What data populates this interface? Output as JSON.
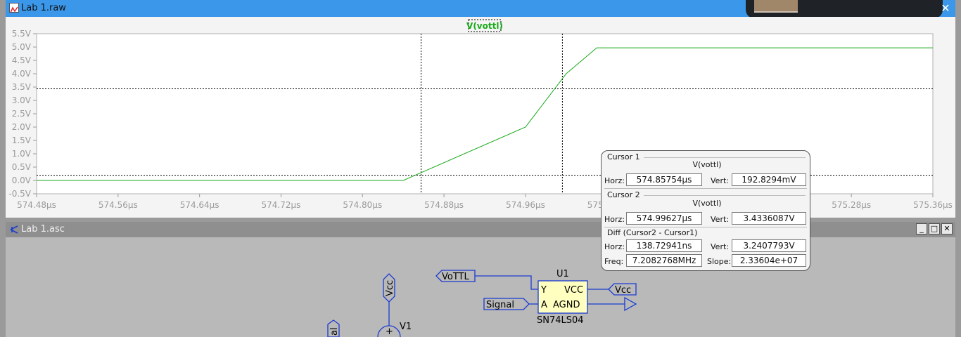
{
  "wave_window": {
    "title": "Lab 1.raw",
    "close_label": "✕",
    "trace_label": "V(vottl)",
    "colors": {
      "trace": "#1aaa1a",
      "grid_tick": "#9a9a9a",
      "titlebar": "#3b97ea"
    }
  },
  "chart_data": {
    "type": "line",
    "title": "",
    "xlabel": "",
    "ylabel": "",
    "x_ticks": [
      "574.48µs",
      "574.56µs",
      "574.64µs",
      "574.72µs",
      "574.80µs",
      "574.88µs",
      "574.96µs",
      "575.04µs",
      "575.12µs",
      "575.20µs",
      "575.28µs",
      "575.36µs"
    ],
    "y_ticks": [
      "5.5V",
      "5.0V",
      "4.5V",
      "4.0V",
      "3.5V",
      "3.0V",
      "2.5V",
      "2.0V",
      "1.5V",
      "1.0V",
      "0.5V",
      "0.0V",
      "-0.5V"
    ],
    "xlim_us": [
      574.48,
      575.36
    ],
    "ylim_v": [
      -0.5,
      5.5
    ],
    "series": [
      {
        "name": "V(vottl)",
        "x_us": [
          574.48,
          574.84,
          574.96,
          575.0,
          575.03,
          575.36
        ],
        "y_v": [
          0.0,
          0.0,
          2.0,
          4.0,
          4.97,
          4.97
        ]
      }
    ],
    "cursors": {
      "x1_us": 574.85754,
      "x2_us": 574.99627,
      "y1_v": 0.1928294,
      "y2_v": 3.4336087
    }
  },
  "cursor_dialog": {
    "cursor1": {
      "group": "Cursor 1",
      "trace": "V(vottl)",
      "horz_label": "Horz:",
      "horz": "574.85754µs",
      "vert_label": "Vert:",
      "vert": "192.8294mV"
    },
    "cursor2": {
      "group": "Cursor 2",
      "trace": "V(vottl)",
      "horz_label": "Horz:",
      "horz": "574.99627µs",
      "vert_label": "Vert:",
      "vert": "3.4336087V"
    },
    "diff": {
      "group": "Diff (Cursor2 - Cursor1)",
      "horz_label": "Horz:",
      "horz": "138.72941ns",
      "vert_label": "Vert:",
      "vert": "3.2407793V",
      "freq_label": "Freq:",
      "freq": "7.2082768MHz",
      "slope_label": "Slope:",
      "slope": "2.33604e+07"
    }
  },
  "schematic_window": {
    "title": "Lab 1.asc",
    "minimize_label": "_",
    "maximize_label": "□",
    "close_label": "✕",
    "labels": {
      "vcc_net_left": "Vcc",
      "v1": "V1",
      "signal_partial": "al",
      "vottl_net": "VoTTL",
      "u1": "U1",
      "pin_y": "Y",
      "pin_vcc": "VCC",
      "pin_a": "A",
      "pin_agnd": "AGND",
      "signal_net": "Signal",
      "vcc_net_right": "Vcc",
      "part": "SN74LS04"
    }
  }
}
